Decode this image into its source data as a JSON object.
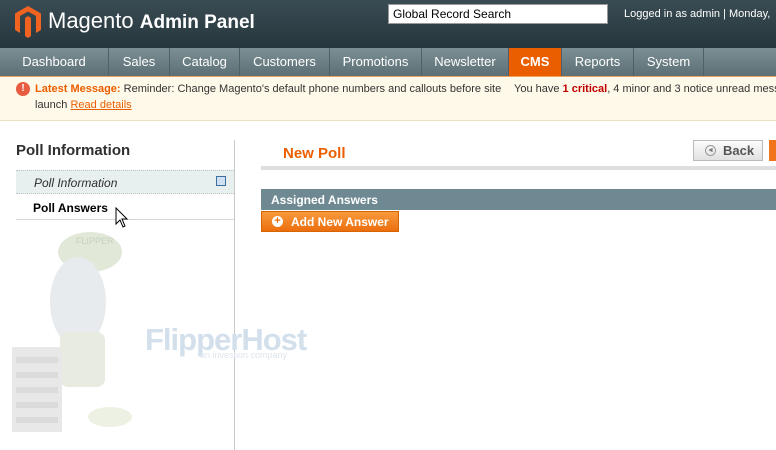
{
  "header": {
    "brand_name": "Magento",
    "brand_sub": "Admin Panel",
    "search_value": "Global Record Search",
    "login_text": "Logged in as admin  |  Monday,"
  },
  "nav": {
    "items": [
      "Dashboard",
      "Sales",
      "Catalog",
      "Customers",
      "Promotions",
      "Newsletter",
      "CMS",
      "Reports",
      "System"
    ],
    "active": "CMS"
  },
  "message": {
    "label": "Latest Message:",
    "text": "Reminder: Change Magento's default phone numbers and callouts before site",
    "text2": "launch",
    "link": "Read details",
    "right_prefix": "You have",
    "critical": "1 critical",
    "right_mid": ", 4 minor and 3 notice unread messa"
  },
  "sidebar": {
    "title": "Poll Information",
    "tabs": [
      {
        "label": "Poll Information",
        "icon": "save-icon"
      },
      {
        "label": "Poll Answers"
      }
    ]
  },
  "watermark": {
    "text": "FlipperHost",
    "sub": "an investion company",
    "cap": "FLIPPER"
  },
  "main": {
    "title": "New Poll",
    "back_label": "Back",
    "section_title": "Assigned Answers",
    "add_answer_label": "Add New Answer"
  },
  "colors": {
    "accent": "#eb5e00",
    "header": "#2e3e45",
    "nav": "#6b7f85",
    "section": "#6f8992"
  }
}
